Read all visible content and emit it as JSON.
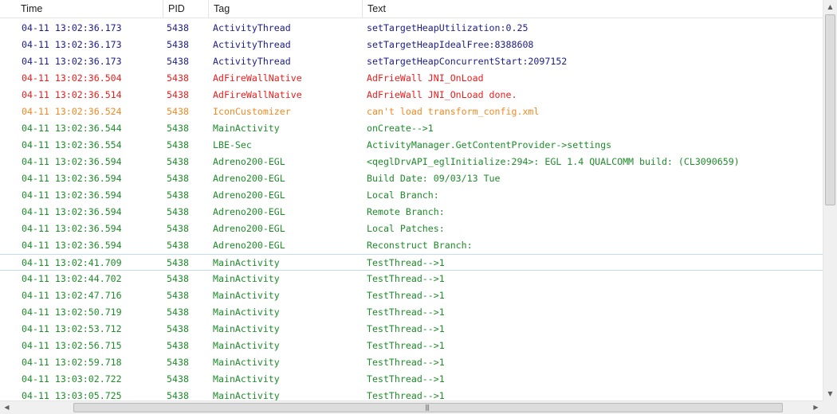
{
  "columns": {
    "time": "Time",
    "pid": "PID",
    "tag": "Tag",
    "text": "Text"
  },
  "level_colors": {
    "info": "#1c1c8a",
    "error": "#ee1c1c",
    "warn": "#f08a24",
    "debug": "#1e8c2a"
  },
  "rows": [
    {
      "time": "04-11 13:02:36.173",
      "pid": "5438",
      "tag": "ActivityThread",
      "text": "setTargetHeapUtilization:0.25",
      "level": "info"
    },
    {
      "time": "04-11 13:02:36.173",
      "pid": "5438",
      "tag": "ActivityThread",
      "text": "setTargetHeapIdealFree:8388608",
      "level": "info"
    },
    {
      "time": "04-11 13:02:36.173",
      "pid": "5438",
      "tag": "ActivityThread",
      "text": "setTargetHeapConcurrentStart:2097152",
      "level": "info"
    },
    {
      "time": "04-11 13:02:36.504",
      "pid": "5438",
      "tag": "AdFireWallNative",
      "text": "AdFrieWall JNI_OnLoad",
      "level": "error"
    },
    {
      "time": "04-11 13:02:36.514",
      "pid": "5438",
      "tag": "AdFireWallNative",
      "text": "AdFrieWall JNI_OnLoad done.",
      "level": "error"
    },
    {
      "time": "04-11 13:02:36.524",
      "pid": "5438",
      "tag": "IconCustomizer",
      "text": "can't load transform_config.xml",
      "level": "warn"
    },
    {
      "time": "04-11 13:02:36.544",
      "pid": "5438",
      "tag": "MainActivity",
      "text": "onCreate-->1",
      "level": "debug"
    },
    {
      "time": "04-11 13:02:36.554",
      "pid": "5438",
      "tag": "LBE-Sec",
      "text": "ActivityManager.GetContentProvider->settings",
      "level": "debug"
    },
    {
      "time": "04-11 13:02:36.594",
      "pid": "5438",
      "tag": "Adreno200-EGL",
      "text": "<qeglDrvAPI_eglInitialize:294>: EGL 1.4 QUALCOMM build:  (CL3090659)",
      "level": "debug"
    },
    {
      "time": "04-11 13:02:36.594",
      "pid": "5438",
      "tag": "Adreno200-EGL",
      "text": "Build Date: 09/03/13 Tue",
      "level": "debug"
    },
    {
      "time": "04-11 13:02:36.594",
      "pid": "5438",
      "tag": "Adreno200-EGL",
      "text": "Local Branch:",
      "level": "debug"
    },
    {
      "time": "04-11 13:02:36.594",
      "pid": "5438",
      "tag": "Adreno200-EGL",
      "text": "Remote Branch:",
      "level": "debug"
    },
    {
      "time": "04-11 13:02:36.594",
      "pid": "5438",
      "tag": "Adreno200-EGL",
      "text": "Local Patches:",
      "level": "debug"
    },
    {
      "time": "04-11 13:02:36.594",
      "pid": "5438",
      "tag": "Adreno200-EGL",
      "text": "Reconstruct Branch:",
      "level": "debug"
    },
    {
      "time": "04-11 13:02:41.709",
      "pid": "5438",
      "tag": "MainActivity",
      "text": "TestThread-->1",
      "level": "debug",
      "selected": true
    },
    {
      "time": "04-11 13:02:44.702",
      "pid": "5438",
      "tag": "MainActivity",
      "text": "TestThread-->1",
      "level": "debug"
    },
    {
      "time": "04-11 13:02:47.716",
      "pid": "5438",
      "tag": "MainActivity",
      "text": "TestThread-->1",
      "level": "debug"
    },
    {
      "time": "04-11 13:02:50.719",
      "pid": "5438",
      "tag": "MainActivity",
      "text": "TestThread-->1",
      "level": "debug"
    },
    {
      "time": "04-11 13:02:53.712",
      "pid": "5438",
      "tag": "MainActivity",
      "text": "TestThread-->1",
      "level": "debug"
    },
    {
      "time": "04-11 13:02:56.715",
      "pid": "5438",
      "tag": "MainActivity",
      "text": "TestThread-->1",
      "level": "debug"
    },
    {
      "time": "04-11 13:02:59.718",
      "pid": "5438",
      "tag": "MainActivity",
      "text": "TestThread-->1",
      "level": "debug"
    },
    {
      "time": "04-11 13:03:02.722",
      "pid": "5438",
      "tag": "MainActivity",
      "text": "TestThread-->1",
      "level": "debug"
    },
    {
      "time": "04-11 13:03:05.725",
      "pid": "5438",
      "tag": "MainActivity",
      "text": "TestThread-->1",
      "level": "debug"
    }
  ],
  "scrollbars": {
    "up_icon": "arrow-up-icon",
    "down_icon": "arrow-down-icon",
    "left_icon": "arrow-left-icon",
    "right_icon": "arrow-right-icon",
    "grip_icon": "grip-icon"
  }
}
